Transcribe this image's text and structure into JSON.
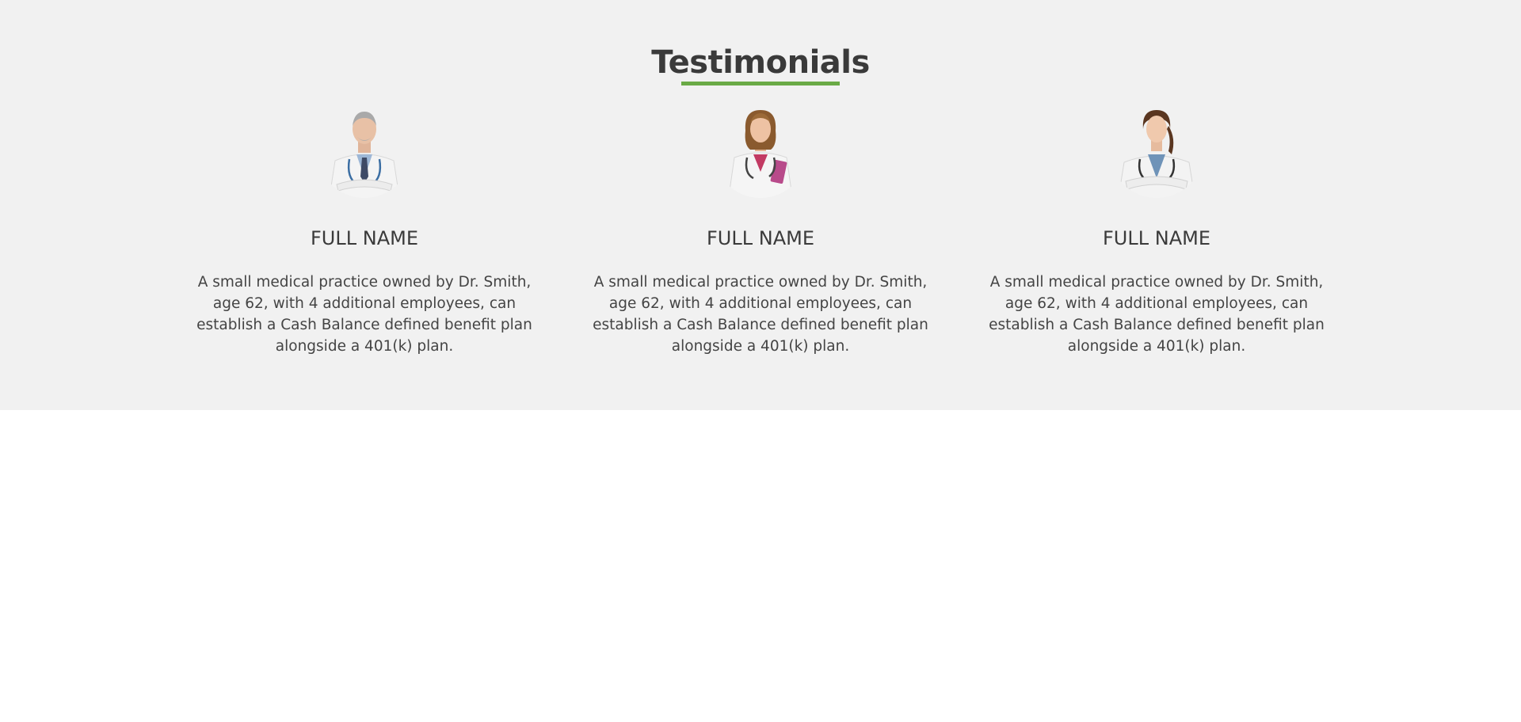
{
  "colors": {
    "section_bg": "#f1f1f1",
    "page_bg": "#ffffff",
    "accent_underline": "#6aaa46",
    "text": "#3a3a3a"
  },
  "testimonials": {
    "title": "Testimonials",
    "items": [
      {
        "avatar_icon": "male-doctor-avatar",
        "name": "FULL NAME",
        "quote": "A small medical practice owned by Dr. Smith, age 62, with 4 additional employees, can establish a Cash Balance defined benefit plan alongside a 401(k) plan."
      },
      {
        "avatar_icon": "female-doctor-clipboard-avatar",
        "name": "FULL NAME",
        "quote": "A small medical practice owned by Dr. Smith, age 62, with 4 additional employees, can establish a Cash Balance defined benefit plan alongside a 401(k) plan."
      },
      {
        "avatar_icon": "female-doctor-avatar",
        "name": "FULL NAME",
        "quote": "A small medical practice owned by Dr. Smith, age 62, with 4 additional employees, can establish a Cash Balance defined benefit plan alongside a 401(k) plan."
      }
    ]
  }
}
